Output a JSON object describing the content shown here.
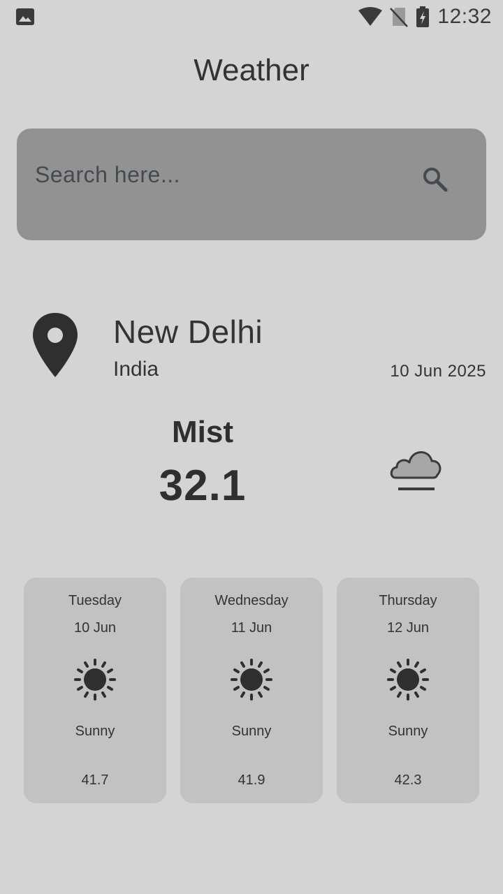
{
  "status_bar": {
    "time": "12:32",
    "icons": [
      "image-icon",
      "wifi-icon",
      "no-sim-icon",
      "battery-charging-icon"
    ]
  },
  "app": {
    "title": "Weather"
  },
  "search": {
    "placeholder": "Search here...",
    "value": "",
    "icon": "search-icon"
  },
  "location": {
    "icon": "location-pin-icon",
    "city": "New Delhi",
    "country": "India",
    "date": "10 Jun 2025"
  },
  "current": {
    "condition": "Mist",
    "temperature": "32.1",
    "icon": "mist-icon"
  },
  "forecast": [
    {
      "day": "Tuesday",
      "date": "10 Jun",
      "icon": "sun-icon",
      "condition": "Sunny",
      "temp": "41.7"
    },
    {
      "day": "Wednesday",
      "date": "11 Jun",
      "icon": "sun-icon",
      "condition": "Sunny",
      "temp": "41.9"
    },
    {
      "day": "Thursday",
      "date": "12 Jun",
      "icon": "sun-icon",
      "condition": "Sunny",
      "temp": "42.3"
    }
  ],
  "colors": {
    "background": "#d4d4d4",
    "search_bg": "#929292",
    "card_bg": "#c2c2c2",
    "text": "#2f2f2f"
  }
}
